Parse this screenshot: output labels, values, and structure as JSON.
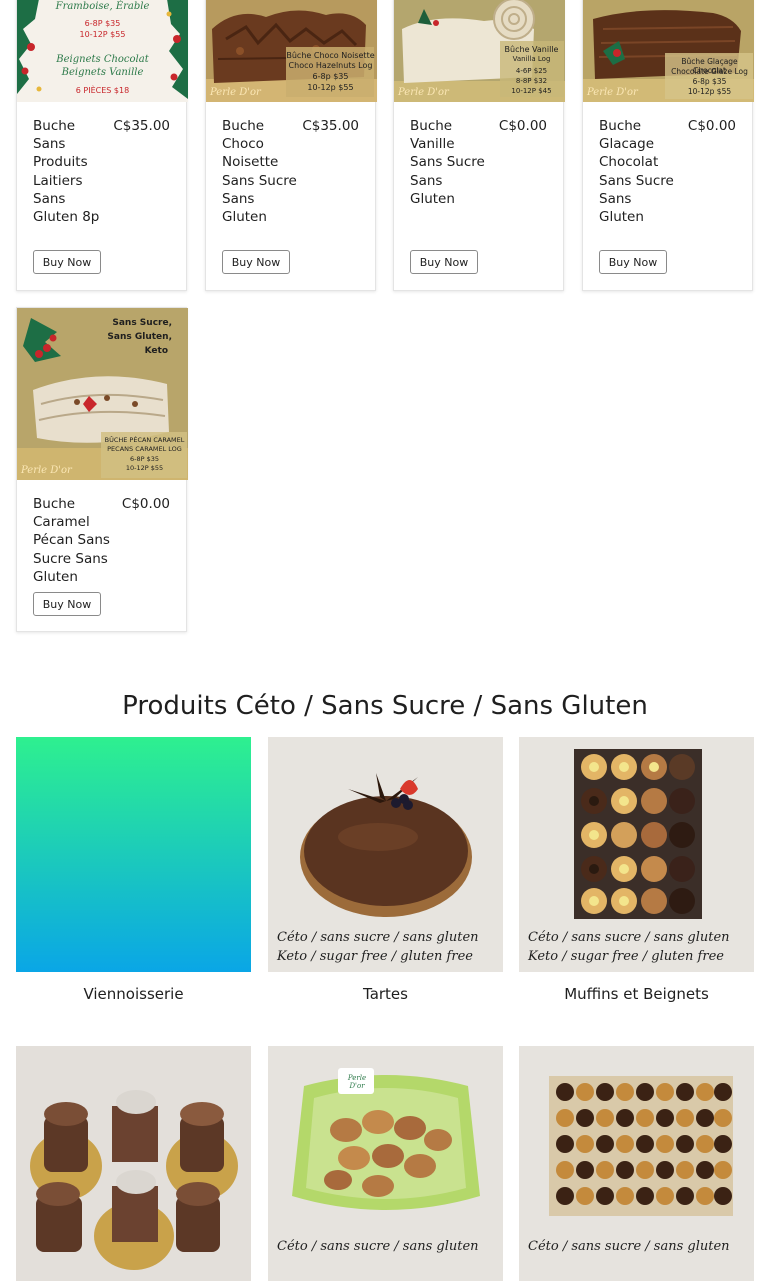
{
  "products": [
    {
      "name": "Buche Sans Produits Laitiers Sans Gluten 8p",
      "price": "C$35.00",
      "button": "Buy Now",
      "image_text": [
        "Framboise, Érable",
        "6-8P $35",
        "10-12P $55",
        "Beignets Chocolat",
        "Beignets Vanille",
        "6 PIÈCES $18"
      ]
    },
    {
      "name": "Buche Choco Noisette Sans Sucre Sans Gluten",
      "price": "C$35.00",
      "button": "Buy Now",
      "image_text": [
        "Bûche Choco Noisette",
        "Choco Hazelnuts Log",
        "6-8p $35",
        "10-12p $55"
      ],
      "logo": "Perle D'or"
    },
    {
      "name": "Buche Vanille Sans Sucre Sans Gluten",
      "price": "C$0.00",
      "button": "Buy Now",
      "image_text": [
        "Bûche Vanille",
        "Vanilla Log",
        "4-6P $25",
        "8-8P $32",
        "10-12P $45"
      ],
      "logo": "Perle D'or"
    },
    {
      "name": "Buche Glacage Chocolat Sans Sucre Sans Gluten",
      "price": "C$0.00",
      "button": "Buy Now",
      "image_text": [
        "Bûche Glaçage Chocolat",
        "Chocolate Glaze Log",
        "6-8p $35",
        "10-12p $55"
      ],
      "logo": "Perle D'or"
    },
    {
      "name": "Buche Caramel Pécan Sans Sucre Sans Gluten",
      "price": "C$0.00",
      "button": "Buy Now",
      "image_text": [
        "Sans Sucre,",
        "Sans Gluten,",
        "Keto",
        "BÛCHE PÉCAN CARAMEL",
        "PECANS CARAMEL LOG",
        "6-8P $35",
        "10-12P $55"
      ],
      "logo": "Perle D'or"
    }
  ],
  "section_title": "Produits Céto / Sans Sucre / Sans Gluten",
  "categories": [
    {
      "label": "Viennoisserie"
    },
    {
      "label": "Tartes",
      "caption": [
        "Céto / sans sucre / sans gluten",
        "Keto / sugar free / gluten free"
      ]
    },
    {
      "label": "Muffins et Beignets",
      "caption": [
        "Céto / sans sucre / sans gluten",
        "Keto / sugar free / gluten free"
      ]
    },
    {
      "label": ""
    },
    {
      "label": "",
      "caption": [
        "Céto / sans sucre / sans gluten"
      ],
      "pack_label": "Perle D'or"
    },
    {
      "label": "",
      "caption": [
        "Céto / sans sucre / sans gluten"
      ]
    }
  ],
  "colors": {
    "text": "#1f1f1f",
    "card_border": "#e4e4e4",
    "button_border": "#8a8a8a",
    "gradient_top": "#2ef08f",
    "gradient_bottom": "#0aa6e6"
  }
}
